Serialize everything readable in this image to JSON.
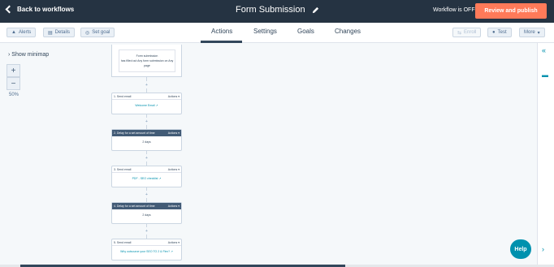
{
  "topbar": {
    "back_label": "Back to workflows",
    "title": "Form Submission",
    "status": "Workflow is OFF",
    "review_label": "Review and publish"
  },
  "subbar": {
    "alerts": "Alerts",
    "details": "Details",
    "set_goal": "Set goal",
    "tabs": [
      "Actions",
      "Settings",
      "Goals",
      "Changes"
    ],
    "enroll": "Enroll",
    "test": "Test",
    "more": "More"
  },
  "minimap": {
    "toggle": "Show minimap",
    "zoom_in": "+",
    "zoom_out": "−",
    "zoom": "50%"
  },
  "canvas": {
    "trigger_title": "Form submission",
    "trigger_text": "has filled out Any form submission on Any page",
    "actions_label": "Actions ▾",
    "steps": [
      {
        "head": "1. Send email",
        "body": "Welcome Email ↗",
        "dark": false
      },
      {
        "head": "2. Delay for a set amount of time",
        "body": "2 days",
        "dark": true
      },
      {
        "head": "3. Send email",
        "body": "PDF - SEO checklist ↗",
        "dark": false
      },
      {
        "head": "4. Delay for a set amount of time",
        "body": "2 days",
        "dark": true
      },
      {
        "head": "5. Send email",
        "body": "Why outsource your SEO TO 2 & Flex? ↗",
        "dark": false
      }
    ]
  },
  "help_label": "Help",
  "colors": {
    "accent": "#ff7a59",
    "dark": "#253342",
    "link": "#0091ae"
  }
}
